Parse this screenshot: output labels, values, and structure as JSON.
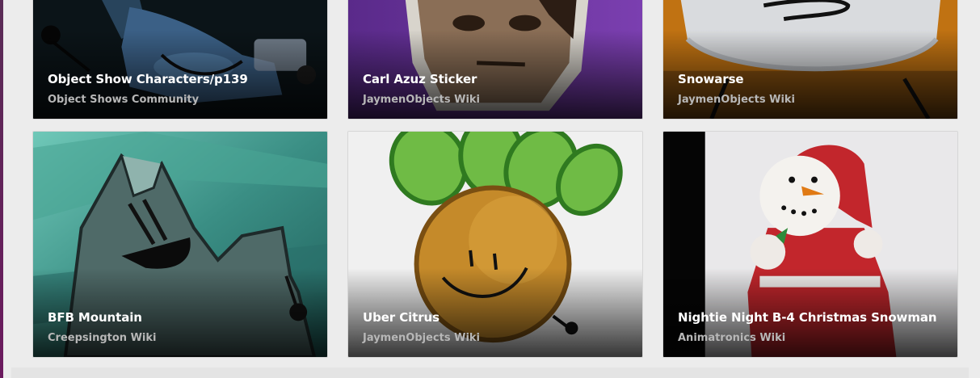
{
  "cards": [
    {
      "title": "Object Show Characters/p139",
      "source": "Object Shows Community"
    },
    {
      "title": "Carl Azuz Sticker",
      "source": "JaymenObjects Wiki"
    },
    {
      "title": "Snowarse",
      "source": "JaymenObjects Wiki"
    },
    {
      "title": "BFB Mountain",
      "source": "Creepsington Wiki"
    },
    {
      "title": "Uber Citrus",
      "source": "JaymenObjects Wiki"
    },
    {
      "title": "Nightie Night B-4 Christmas Snowman",
      "source": "Animatronics Wiki"
    }
  ],
  "colors": {
    "page_background": "#ececec",
    "title_text": "#ffffff",
    "source_text": "#b7b7b7"
  }
}
